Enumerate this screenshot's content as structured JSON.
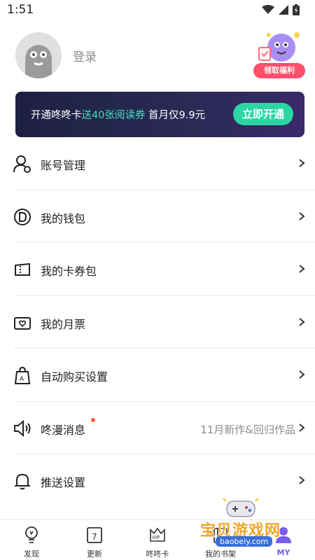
{
  "status_bar": {
    "time": "1:51"
  },
  "profile": {
    "login_label": "登录",
    "welfare_label": "领取福利"
  },
  "vip_banner": {
    "text_part1": "开通咚咚卡",
    "text_highlight": "送40张阅读券",
    "text_part2": " 首月仅9.9元",
    "button_label": "立即开通"
  },
  "menu": {
    "items": [
      {
        "label": "账号管理",
        "icon": "account-manage-icon"
      },
      {
        "label": "我的钱包",
        "icon": "wallet-icon"
      },
      {
        "label": "我的卡券包",
        "icon": "coupon-icon"
      },
      {
        "label": "我的月票",
        "icon": "monthly-ticket-icon"
      },
      {
        "label": "自动购买设置",
        "icon": "auto-buy-icon"
      },
      {
        "label": "咚漫消息",
        "icon": "speaker-icon",
        "extra": "11月新作&回归作品"
      },
      {
        "label": "推送设置",
        "icon": "bell-icon"
      }
    ]
  },
  "tabbar": {
    "tabs": [
      {
        "label": "发现",
        "icon": "lightbulb-icon"
      },
      {
        "label": "更新",
        "icon": "calendar-icon",
        "day": "7"
      },
      {
        "label": "咚咚卡",
        "icon": "vip-crown-icon",
        "badge": "VIP"
      },
      {
        "label": "我的书架",
        "icon": "bookshelf-icon"
      },
      {
        "label": "MY",
        "icon": "profile-icon",
        "active": true
      }
    ]
  },
  "watermark": {
    "text": "宝贝游戏网",
    "url": "baobeiy.com"
  },
  "colors": {
    "accent": "#7b5cf0",
    "vip_button": "#2bd6a4",
    "highlight": "#45e0c0",
    "welfare": "#ff4f6a"
  }
}
